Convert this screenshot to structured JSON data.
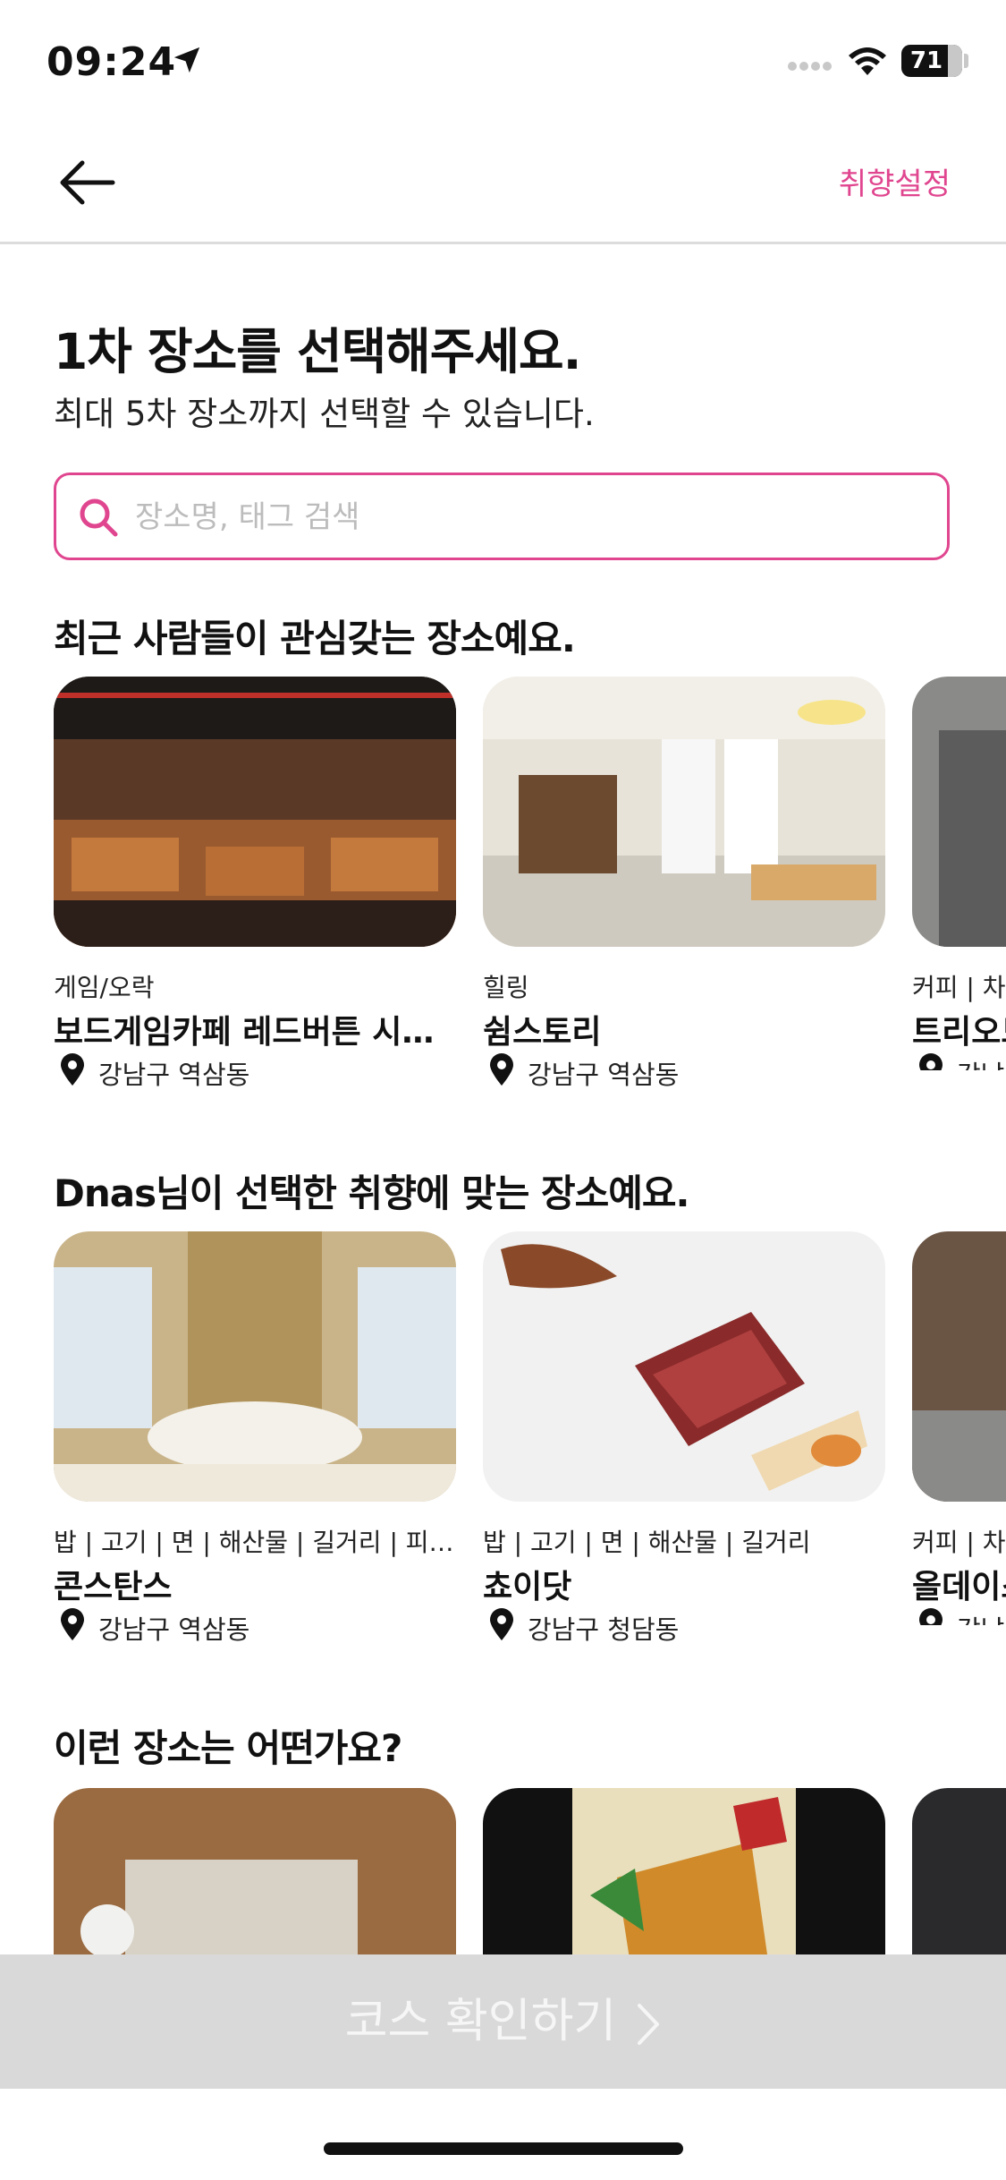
{
  "status": {
    "time": "09:24",
    "battery": "71"
  },
  "nav": {
    "pref_label": "취향설정"
  },
  "header": {
    "title": "1차 장소를 선택해주세요.",
    "subtitle": "최대 5차 장소까지 선택할 수 있습니다."
  },
  "search": {
    "placeholder": "장소명, 태그 검색",
    "value": ""
  },
  "sections": [
    {
      "title": "최근 사람들이 관심갖는 장소예요.",
      "cards": [
        {
          "category": "게임/오락",
          "name": "보드게임카페 레드버튼 시네…",
          "location": "강남구 역삼동"
        },
        {
          "category": "힐링",
          "name": "쉼스토리",
          "location": "강남구 역삼동"
        },
        {
          "category": "커피 | 차,",
          "name": "트리오드",
          "location": "강남구"
        }
      ]
    },
    {
      "title": "Dnas님이 선택한 취향에 맞는 장소예요.",
      "cards": [
        {
          "category": "밥 | 고기 | 면 | 해산물 | 길거리 | 피…",
          "name": "콘스탄스",
          "location": "강남구 역삼동"
        },
        {
          "category": "밥 | 고기 | 면 | 해산물 | 길거리",
          "name": "쵸이닷",
          "location": "강남구 청담동"
        },
        {
          "category": "커피 | 차,",
          "name": "올데이스",
          "location": "강남구"
        }
      ]
    },
    {
      "title": "이런 장소는 어떤가요?",
      "cards": []
    }
  ],
  "cta": {
    "label": "코스 확인하기"
  },
  "colors": {
    "accent": "#e0468f",
    "cta_bg": "#d9d9d9",
    "divider": "#dcdcdc"
  },
  "icons": [
    "location-arrow-icon",
    "wifi-icon",
    "back-arrow-icon",
    "search-icon",
    "map-pin-icon",
    "chevron-right-icon"
  ]
}
